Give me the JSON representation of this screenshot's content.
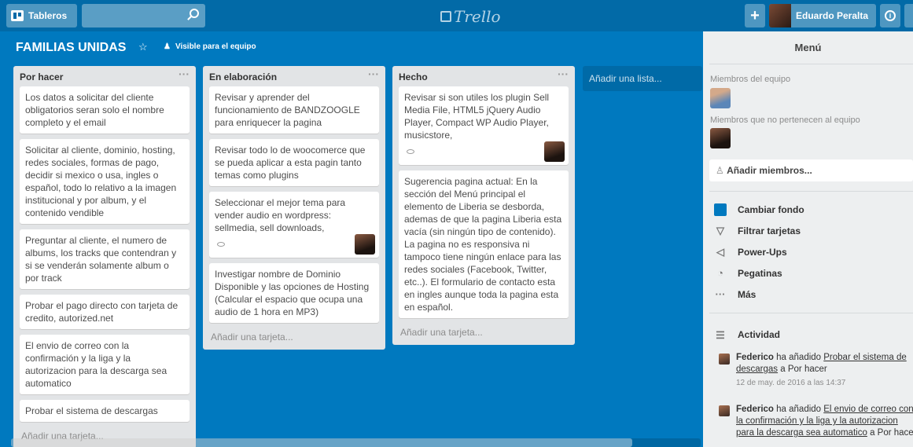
{
  "header": {
    "boards_label": "Tableros",
    "logo_text": "Trello",
    "user_name": "Eduardo Peralta",
    "plus_label": "+",
    "info_label": "i"
  },
  "board": {
    "title": "FAMILIAS UNIDAS",
    "visibility": "Visible para el equipo"
  },
  "lists": [
    {
      "title": "Por hacer",
      "cards": [
        "Los datos a solicitar del cliente obligatorios seran solo el nombre completo y el email",
        "Solicitar al cliente, dominio, hosting, redes sociales, formas de pago, decidir si mexico o usa, ingles o español, todo lo relativo a la imagen institucional y por album, y el contenido vendible",
        "Preguntar al cliente, el numero de albums, los tracks que contendran y si se venderán solamente album o por track",
        "Probar el pago directo con tarjeta de credito, autorized.net",
        "El envio de correo con la confirmación y la liga y la autorizacion para la descarga sea automatico",
        "Probar el sistema de descargas"
      ],
      "add_card": "Añadir una tarjeta..."
    },
    {
      "title": "En elaboración",
      "cards": [
        "Revisar y aprender del funcionamiento de BANDZOOGLE para enriquecer la pagina",
        "Revisar todo lo de woocomerce que se pueda aplicar a esta pagin tanto temas como plugins",
        "Seleccionar el mejor tema para vender audio en wordpress: sellmedia, sell downloads,",
        "Investigar nombre de Dominio Disponible y las opciones de Hosting (Calcular el espacio que ocupa una audio de 1 hora en MP3)"
      ],
      "add_card": "Añadir una tarjeta..."
    },
    {
      "title": "Hecho",
      "cards": [
        "Revisar si son utiles los plugin Sell Media File, HTML5 jQuery Audio Player, Compact WP Audio Player, musicstore,",
        "Sugerencia pagina actual: En la sección del Menú principal el elemento de Liberia se desborda, ademas de que la pagina Liberia esta vacía (sin ningún tipo de contenido). La pagina no es responsiva ni tampoco tiene ningún enlace para las redes sociales (Facebook, Twitter, etc..). El formulario de contacto esta en ingles aunque toda la pagina esta en español."
      ],
      "add_card": "Añadir una tarjeta..."
    }
  ],
  "add_list": "Añadir una lista...",
  "sidebar": {
    "title": "Menú",
    "team_members_label": "Miembros del equipo",
    "non_team_label": "Miembros que no pertenecen al equipo",
    "add_members": "Añadir miembros...",
    "items": [
      "Cambiar fondo",
      "Filtrar tarjetas",
      "Power-Ups",
      "Pegatinas",
      "Más"
    ],
    "activity_label": "Actividad",
    "activities": [
      {
        "name": "Federico",
        "verb": "ha añadido",
        "link": "Probar el sistema de descargas",
        "suffix": "a Por hacer",
        "date": "12 de may. de 2016 a las 14:37"
      },
      {
        "name": "Federico",
        "verb": "ha añadido",
        "link": "El envio de correo con la confirmación y la liga y la autorizacion para la descarga sea automatico",
        "suffix": "a Por hacer",
        "date": ""
      }
    ]
  }
}
